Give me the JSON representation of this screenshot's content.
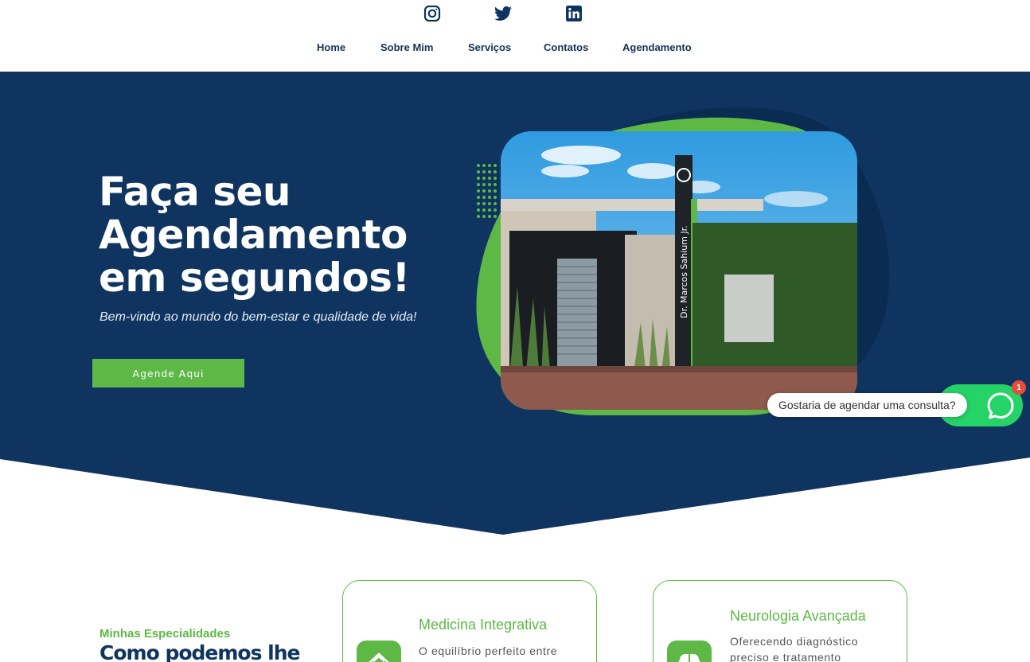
{
  "social": {
    "instagram_icon": "instagram-icon",
    "twitter_icon": "twitter-icon",
    "linkedin_icon": "linkedin-icon"
  },
  "nav": {
    "items": [
      "Home",
      "Sobre Mim",
      "Serviços",
      "Contatos",
      "Agendamento"
    ]
  },
  "hero": {
    "title_line1": "Faça seu",
    "title_line2": "Agendamento",
    "title_line3": "em segundos!",
    "subtitle": "Bem-vindo ao mundo do bem-estar e qualidade de vida!",
    "cta_label": "Agende Aqui",
    "sign_text": "Dr. Marcos Sahium Jr."
  },
  "whatsapp": {
    "bubble_text": "Gostaria de agendar uma consulta?",
    "badge_count": "1",
    "icon": "whatsapp-icon"
  },
  "specialities": {
    "kicker": "Minhas Especialidades",
    "heading": "Como podemos lhe",
    "cards": [
      {
        "title": "Medicina Integrativa",
        "text": "O equilíbrio perfeito entre",
        "icon": "home-icon"
      },
      {
        "title": "Neurologia Avançada",
        "text": "Oferecendo diagnóstico preciso e tratamento",
        "icon": "brain-icon"
      }
    ]
  },
  "colors": {
    "navy": "#0f3460",
    "green": "#5db846",
    "whatsapp": "#25d366"
  }
}
